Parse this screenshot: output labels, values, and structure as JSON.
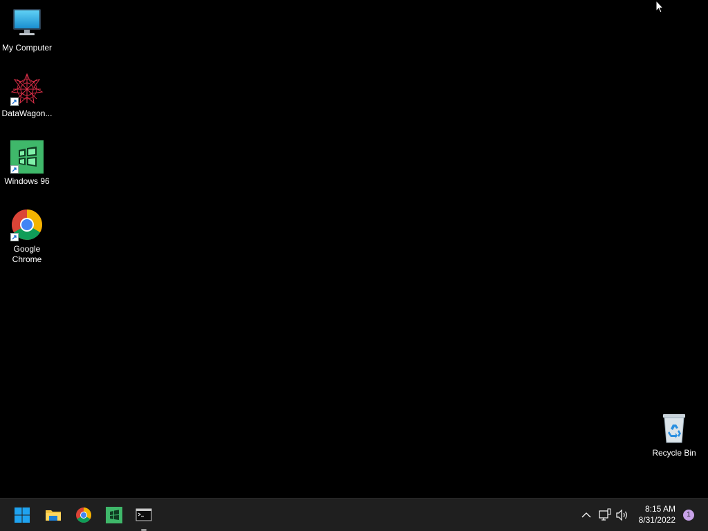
{
  "desktop": {
    "background_color": "#000000",
    "icons": [
      {
        "label": "My Computer",
        "icon": "monitor-icon",
        "shortcut": false
      },
      {
        "label": "DataWagon...",
        "icon": "datawagon-icon",
        "shortcut": true
      },
      {
        "label": "Windows 96",
        "icon": "windows96-icon",
        "shortcut": true
      },
      {
        "label": "Google Chrome",
        "icon": "chrome-icon",
        "shortcut": true
      },
      {
        "label": "Recycle Bin",
        "icon": "recycle-bin-icon",
        "shortcut": false
      }
    ]
  },
  "taskbar": {
    "background_color": "#1f1f1f",
    "pinned": [
      {
        "name": "start",
        "icon": "windows-start-icon"
      },
      {
        "name": "file-explorer",
        "icon": "folder-icon"
      },
      {
        "name": "chrome",
        "icon": "chrome-icon"
      },
      {
        "name": "windows96",
        "icon": "windows96-icon"
      },
      {
        "name": "terminal",
        "icon": "terminal-icon",
        "active": true
      }
    ],
    "tray": {
      "icons": [
        "chevron-up-icon",
        "network-icon",
        "volume-icon"
      ],
      "time": "8:15 AM",
      "date": "8/31/2022",
      "notification_count": "1"
    }
  }
}
